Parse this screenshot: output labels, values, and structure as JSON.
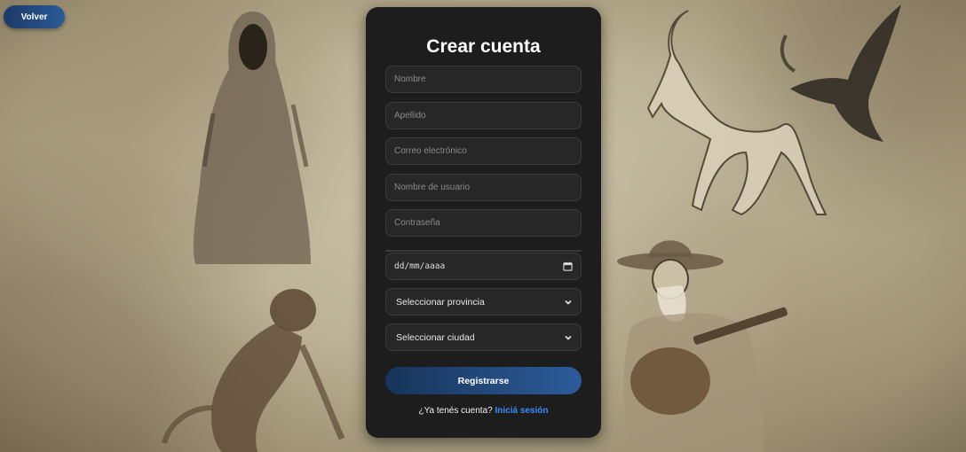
{
  "nav": {
    "back_label": "Volver"
  },
  "form": {
    "title": "Crear cuenta",
    "fields": {
      "nombre": {
        "placeholder": "Nombre"
      },
      "apellido": {
        "placeholder": "Apellido"
      },
      "correo": {
        "placeholder": "Correo electrónico"
      },
      "usuario": {
        "placeholder": "Nombre de usuario"
      },
      "contrasena": {
        "placeholder": "Contraseña"
      },
      "fecha": {
        "placeholder": "dd/mm/aaaa"
      }
    },
    "selects": {
      "provincia": {
        "selected": "Seleccionar provincia"
      },
      "ciudad": {
        "selected": "Seleccionar ciudad"
      }
    },
    "submit_label": "Registrarse",
    "login_prompt": "¿Ya tenés cuenta?",
    "login_link": "Iniciá sesión"
  },
  "colors": {
    "card_bg": "#1d1d1d",
    "button_gradient_start": "#173459",
    "button_gradient_end": "#2d5c9c",
    "link": "#3a8dff"
  },
  "icons": {
    "calendar": "calendar-icon",
    "chevron": "chevron-down-icon"
  }
}
